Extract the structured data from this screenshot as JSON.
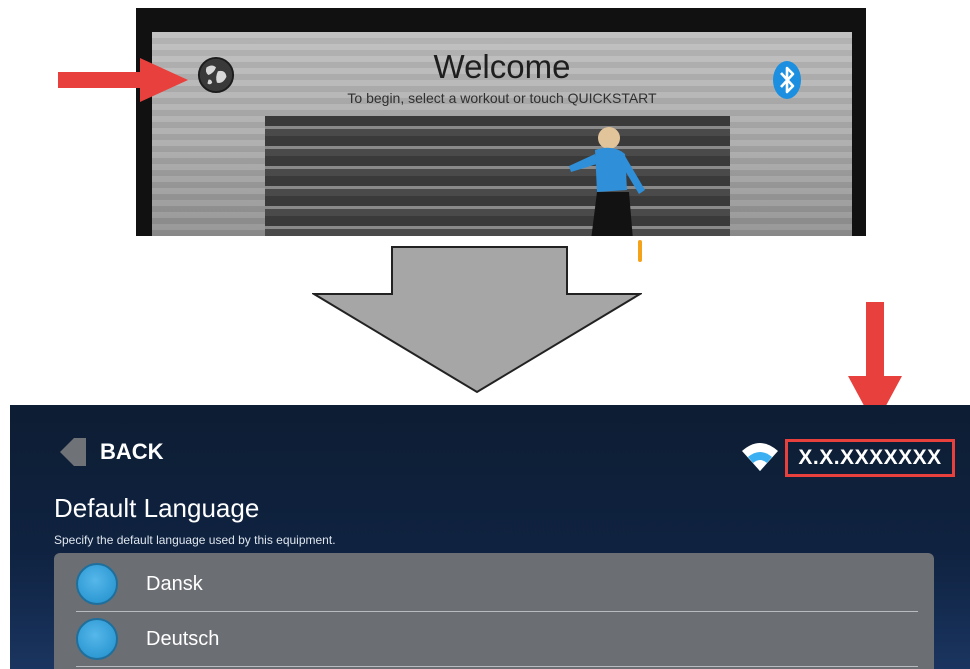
{
  "photo": {
    "welcome_title": "Welcome",
    "welcome_subtitle": "To begin, select a workout or touch QUICKSTART",
    "language_icon": "globe-icon",
    "bluetooth_icon": "bluetooth-icon"
  },
  "settings": {
    "back_label": "BACK",
    "version": "X.X.XXXXXXX",
    "wifi_icon": "wifi-icon",
    "section_title": "Default Language",
    "section_description": "Specify the default language used by this equipment.",
    "languages": [
      {
        "label": "Dansk"
      },
      {
        "label": "Deutsch"
      }
    ]
  },
  "colors": {
    "annotation_red": "#e8403c",
    "panel_navy": "#0f2240",
    "radio_blue": "#2f9ad4",
    "arrow_grey": "#a6a6a6"
  }
}
